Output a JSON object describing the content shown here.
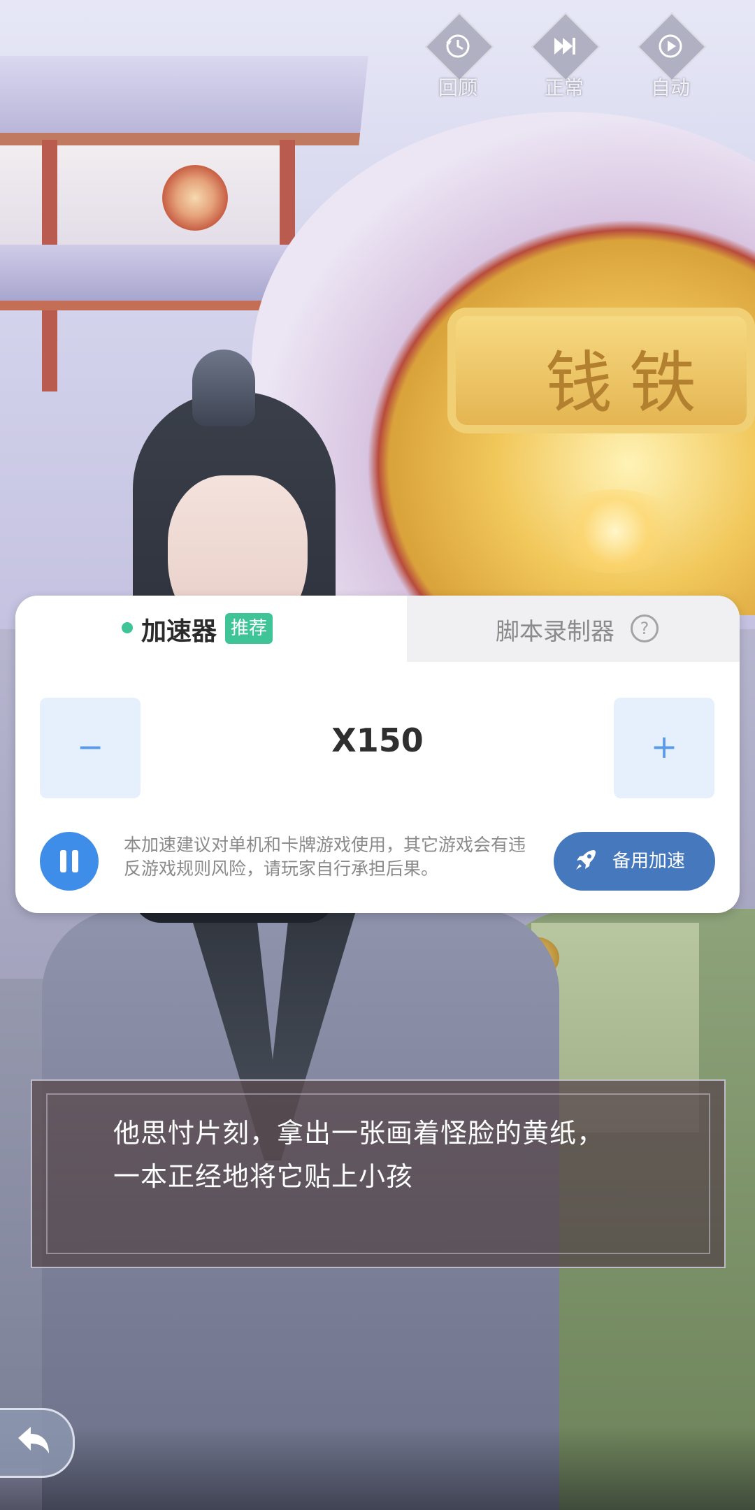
{
  "top_controls": [
    {
      "label": "回顾",
      "icon": "history-icon"
    },
    {
      "label": "正常",
      "icon": "fast-forward-icon"
    },
    {
      "label": "自动",
      "icon": "play-icon"
    }
  ],
  "scene": {
    "plaque_text": "钱铁"
  },
  "accelerator_panel": {
    "tab_active": {
      "label": "加速器",
      "badge": "推荐"
    },
    "tab_inactive": {
      "label": "脚本录制器",
      "help_icon": "?"
    },
    "decrease_label": "−",
    "increase_label": "+",
    "speed_value": "X150",
    "notice": "本加速建议对单机和卡牌游戏使用，其它游戏会有违反游戏规则风险，请玩家自行承担后果。",
    "backup_button_label": "备用加速",
    "accent_green": "#3ec496",
    "accent_blue": "#3e8de8"
  },
  "dialogue": {
    "line1": "他思忖片刻，拿出一张画着怪脸的黄纸，",
    "line2": "一本正经地将它贴上小孩"
  },
  "back_button": {
    "icon": "back-arrow-icon"
  }
}
